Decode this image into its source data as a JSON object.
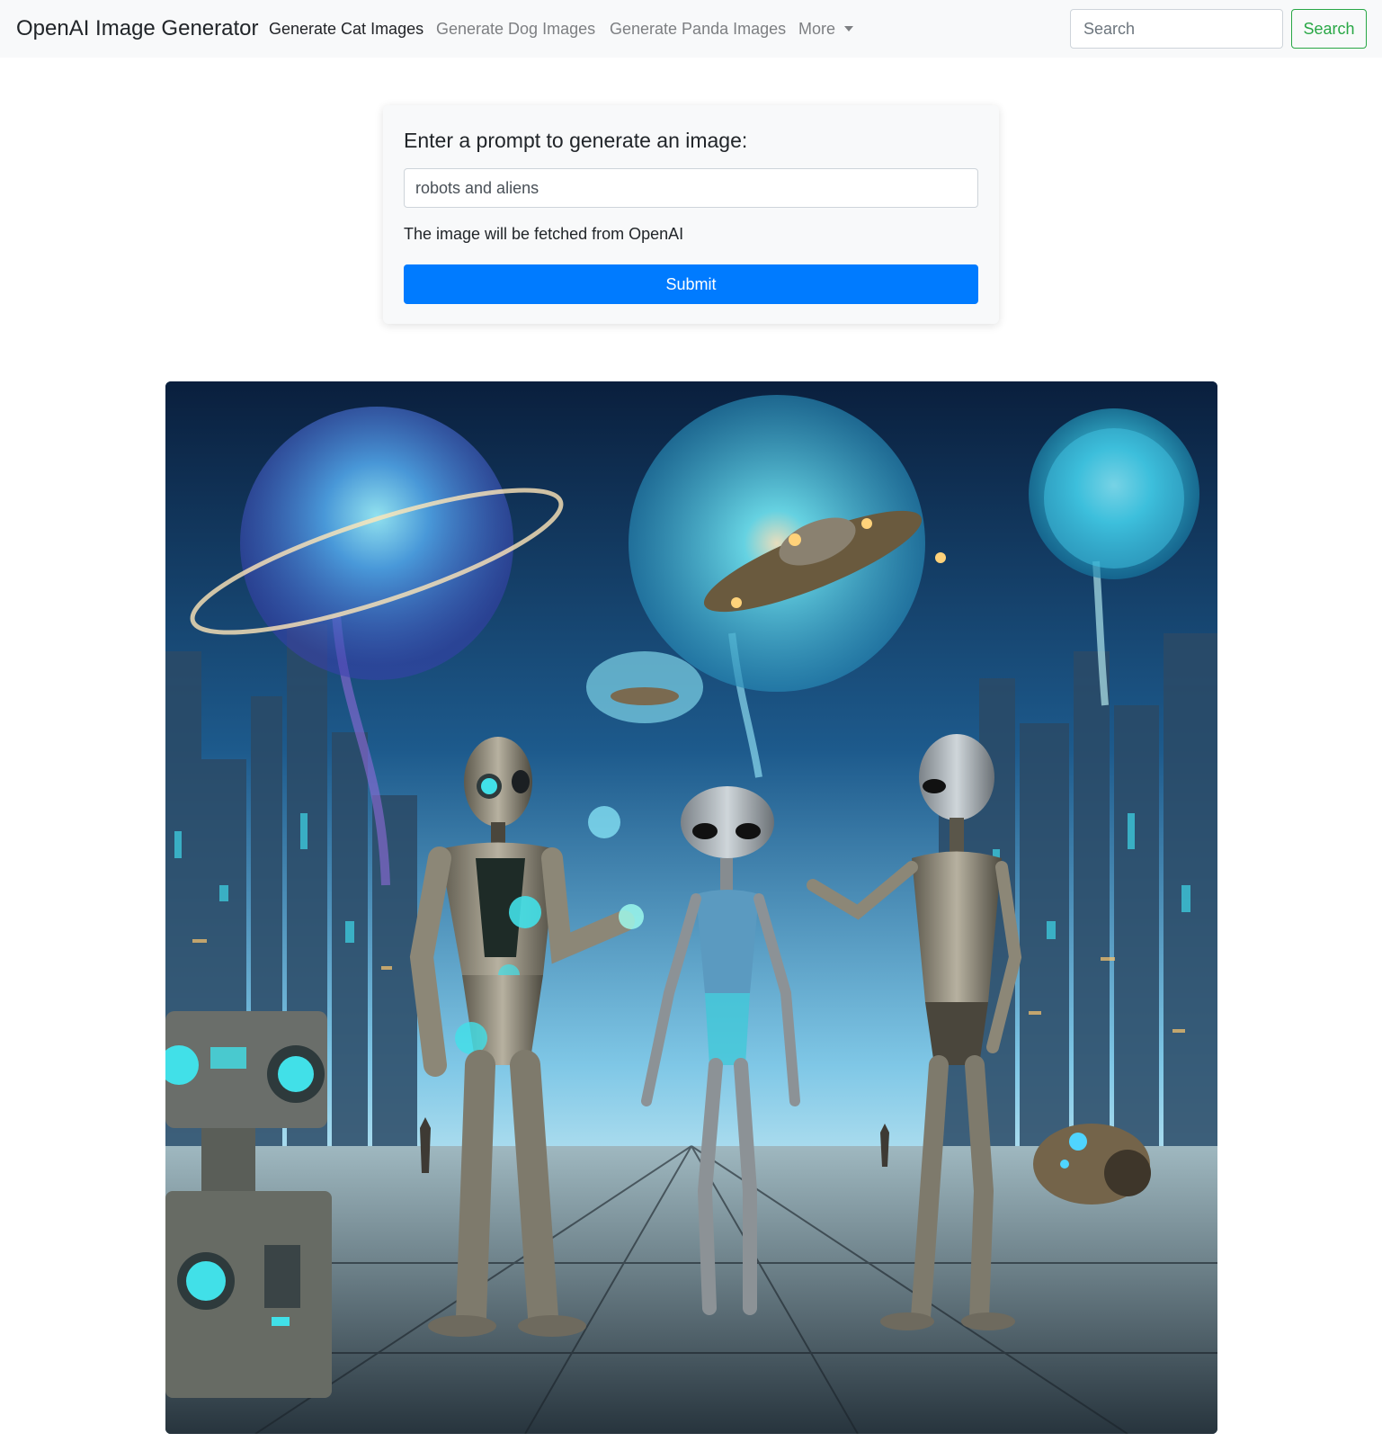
{
  "navbar": {
    "brand": "OpenAI Image Generator",
    "links": [
      {
        "label": "Generate Cat Images",
        "active": true
      },
      {
        "label": "Generate Dog Images",
        "active": false
      },
      {
        "label": "Generate Panda Images",
        "active": false
      }
    ],
    "more_label": "More",
    "search_placeholder": "Search",
    "search_button": "Search"
  },
  "form": {
    "title": "Enter a prompt to generate an image:",
    "prompt_value": "robots and aliens",
    "helper_text": "The image will be fetched from OpenAI",
    "submit_label": "Submit"
  },
  "colors": {
    "primary": "#007bff",
    "success": "#28a745",
    "navbar_bg": "#f8f9fa"
  }
}
